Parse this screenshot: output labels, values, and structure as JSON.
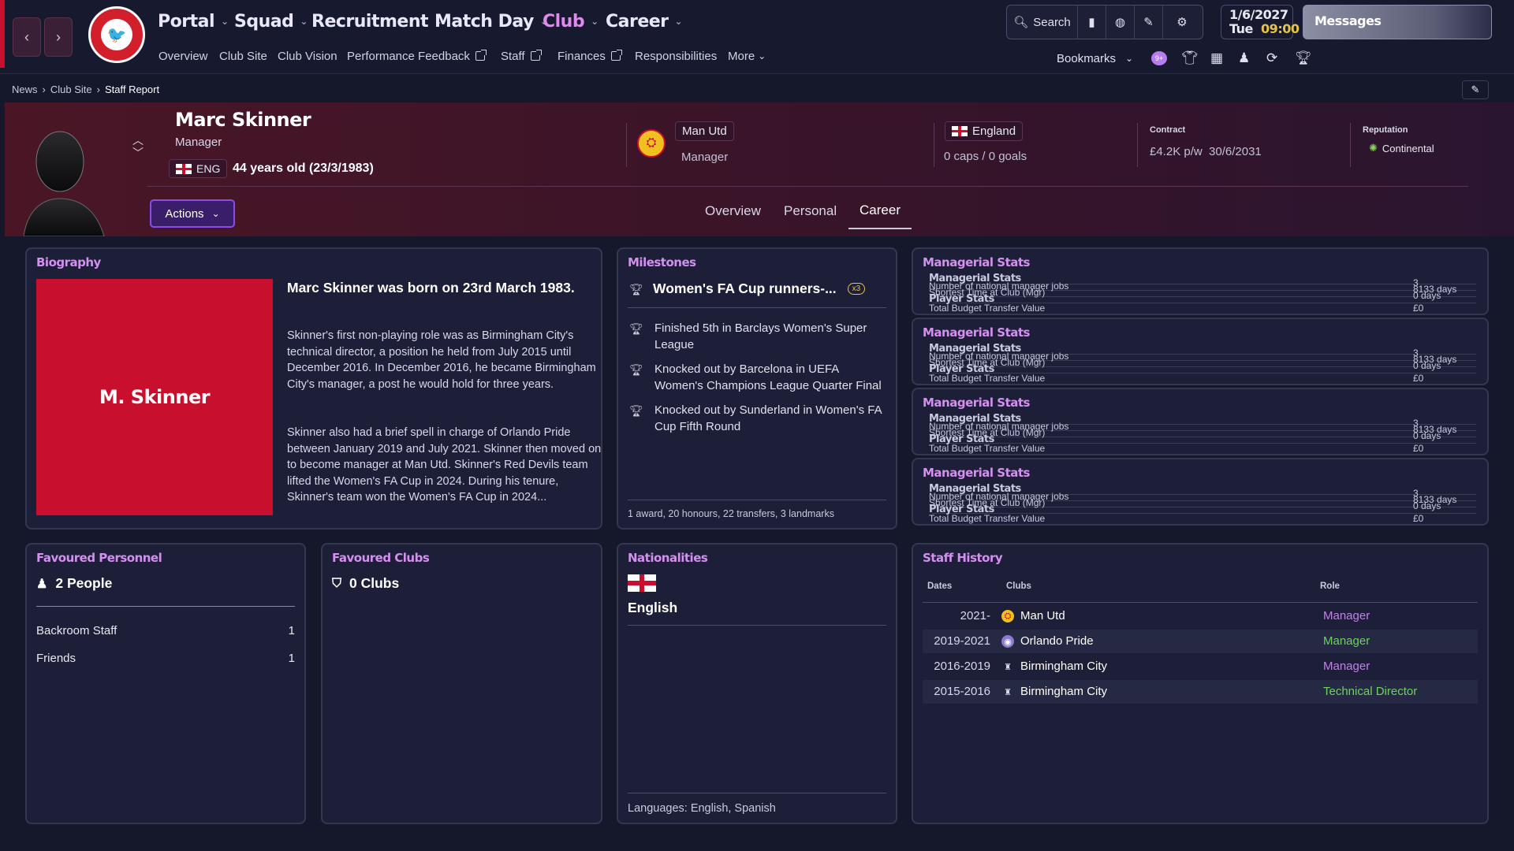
{
  "nav": {
    "back": "‹",
    "forward": "›",
    "crest_text": "BRISTOL CITY",
    "main": [
      "Portal",
      "Squad",
      "Recruitment",
      "Match Day",
      "Club",
      "Career"
    ],
    "sub": [
      "Overview",
      "Club Site",
      "Club Vision",
      "Performance Feedback",
      "Staff",
      "Finances",
      "Responsibilities",
      "More"
    ],
    "search": "Search",
    "date": "1/6/2027",
    "day": "Tue",
    "time": "09:00",
    "messages": "Messages",
    "bookmarks": "Bookmarks",
    "badge": "9+"
  },
  "breadcrumb": [
    "News",
    "Club Site",
    "Staff Report"
  ],
  "person": {
    "name": "Marc Skinner",
    "role": "Manager",
    "nation_code": "ENG",
    "age": "44 years old (23/3/1983)",
    "club": "Man Utd",
    "club_role": "Manager",
    "nation": "England",
    "caps": "0 caps / 0 goals",
    "contract_label": "Contract",
    "contract": "£4.2K p/w  30/6/2031",
    "reputation_label": "Reputation",
    "reputation": "Continental"
  },
  "actions": "Actions",
  "tabs": [
    "Overview",
    "Personal",
    "Career"
  ],
  "biography": {
    "title": "Biography",
    "card_name": "M. Skinner",
    "headline": "Marc Skinner was born on 23rd March 1983.",
    "p1": "Skinner's first non-playing role was as Birmingham City's technical director, a position he held from July 2015 until December 2016. In December 2016, he became Birmingham City's manager, a post he would hold for three years.",
    "p2": "Skinner also had a brief spell in charge of Orlando Pride between January 2019 and July 2021. Skinner then moved on to become manager at Man Utd. Skinner's Red Devils team lifted the Women's FA Cup in 2024. During his tenure, Skinner's team won the Women's FA Cup in 2024..."
  },
  "milestones": {
    "title": "Milestones",
    "headline": "Women's FA Cup runners-...",
    "badge": "x3",
    "items": [
      "Finished 5th in Barclays Women's Super League",
      "Knocked out by Barcelona in UEFA Women's Champions League Quarter Final",
      "Knocked out by Sunderland in Women's FA Cup Fifth Round"
    ],
    "footer": "1 award, 20 honours, 22 transfers, 3 landmarks"
  },
  "managerial_stats": {
    "title": "Managerial Stats",
    "overlap_a": "Managerial Stats",
    "overlap_b": "Number of national manager jobs",
    "overlap_c": "Shortest Time at Club (Mgr)",
    "overlap_d": "Player Stats",
    "overlap_e": "Total Budget Transfer Value",
    "val_a": "3",
    "val_b": "8133 days",
    "val_c": "0 days",
    "val_d": "£0"
  },
  "favoured_personnel": {
    "title": "Favoured Personnel",
    "count": "2 People",
    "rows": [
      {
        "label": "Backroom Staff",
        "value": "1"
      },
      {
        "label": "Friends",
        "value": "1"
      }
    ]
  },
  "favoured_clubs": {
    "title": "Favoured Clubs",
    "count": "0 Clubs"
  },
  "nationalities": {
    "title": "Nationalities",
    "name": "English",
    "languages": "Languages: English, Spanish"
  },
  "staff_history": {
    "title": "Staff History",
    "headers": [
      "Dates",
      "Clubs",
      "Role"
    ],
    "rows": [
      {
        "dates": "2021-",
        "club": "Man Utd",
        "role": "Manager",
        "role_color": "#c77df0"
      },
      {
        "dates": "2019-2021",
        "club": "Orlando Pride",
        "role": "Manager",
        "role_color": "#6bd35a"
      },
      {
        "dates": "2016-2019",
        "club": "Birmingham City",
        "role": "Manager",
        "role_color": "#c77df0"
      },
      {
        "dates": "2015-2016",
        "club": "Birmingham City",
        "role": "Technical Director",
        "role_color": "#6bd35a"
      }
    ]
  },
  "colors": {
    "accent": "#d58ff0",
    "club_active": "#e08af0",
    "brand_red": "#c8102e"
  }
}
